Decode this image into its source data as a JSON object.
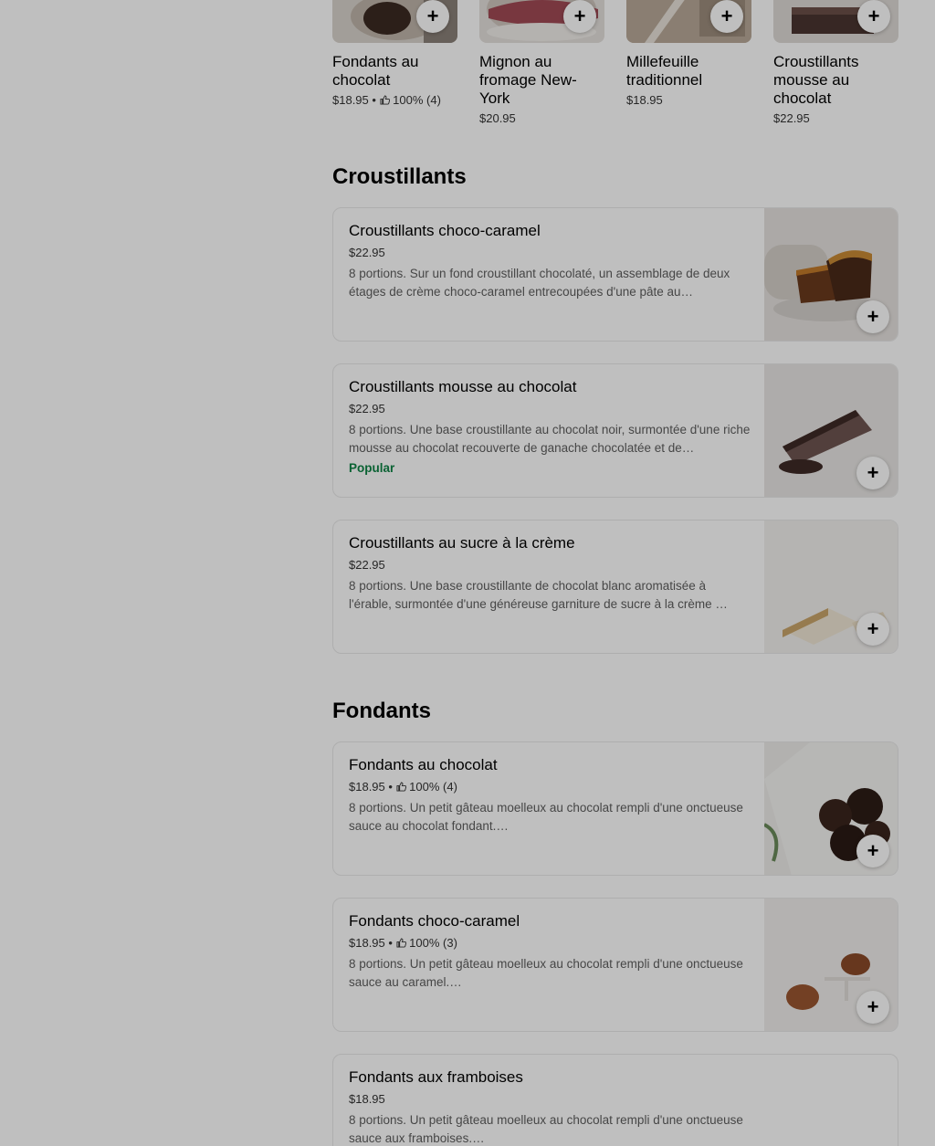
{
  "carousel": [
    {
      "name": "Fondants au chocolat",
      "price": "$18.95",
      "sep": " • ",
      "rating": "100% (4)",
      "has_rating": true,
      "add": "+"
    },
    {
      "name": "Mignon au fromage New-York",
      "price": "$20.95",
      "add": "+"
    },
    {
      "name": "Millefeuille traditionnel",
      "price": "$18.95",
      "add": "+"
    },
    {
      "name": "Croustillants mousse au chocolat",
      "price": "$22.95",
      "add": "+"
    }
  ],
  "sections": [
    {
      "title": "Croustillants",
      "items": [
        {
          "name": "Croustillants choco-caramel",
          "price": "$22.95",
          "desc": "8 portions. Sur un fond croustillant chocolaté, un assemblage de deux étages de crème choco-caramel entrecoupées d'une pâte au…",
          "badge": "",
          "add": "+"
        },
        {
          "name": "Croustillants mousse au chocolat",
          "price": "$22.95",
          "desc": "8 portions. Une base croustillante au chocolat noir, surmontée d'une riche mousse au chocolat recouverte de ganache chocolatée et de…",
          "badge": "Popular",
          "add": "+"
        },
        {
          "name": "Croustillants au sucre à la crème",
          "price": "$22.95",
          "desc": "8 portions. Une base croustillante de chocolat blanc aromatisée à l'érable, surmontée d'une généreuse garniture de sucre à la crème …",
          "badge": "",
          "add": "+"
        }
      ]
    },
    {
      "title": "Fondants",
      "items": [
        {
          "name": "Fondants au chocolat",
          "price": "$18.95",
          "rating": "100% (4)",
          "desc": "8 portions. Un petit gâteau moelleux au chocolat rempli d'une onctueuse sauce au chocolat fondant.…",
          "add": "+"
        },
        {
          "name": "Fondants choco-caramel",
          "price": "$18.95",
          "rating": "100% (3)",
          "desc": "8 portions. Un petit gâteau moelleux au chocolat rempli d'une onctueuse sauce au caramel.…",
          "add": "+"
        },
        {
          "name": "Fondants aux framboises",
          "price": "$18.95",
          "desc": "8 portions. Un petit gâteau moelleux au chocolat rempli d'une onctueuse sauce aux framboises.…"
        }
      ]
    }
  ],
  "colors": {
    "popular": "#0e8345",
    "overlay": "rgba(0,0,0,0.25)"
  },
  "icons": {
    "add": "plus-icon",
    "rating": "thumbs-up-icon"
  }
}
